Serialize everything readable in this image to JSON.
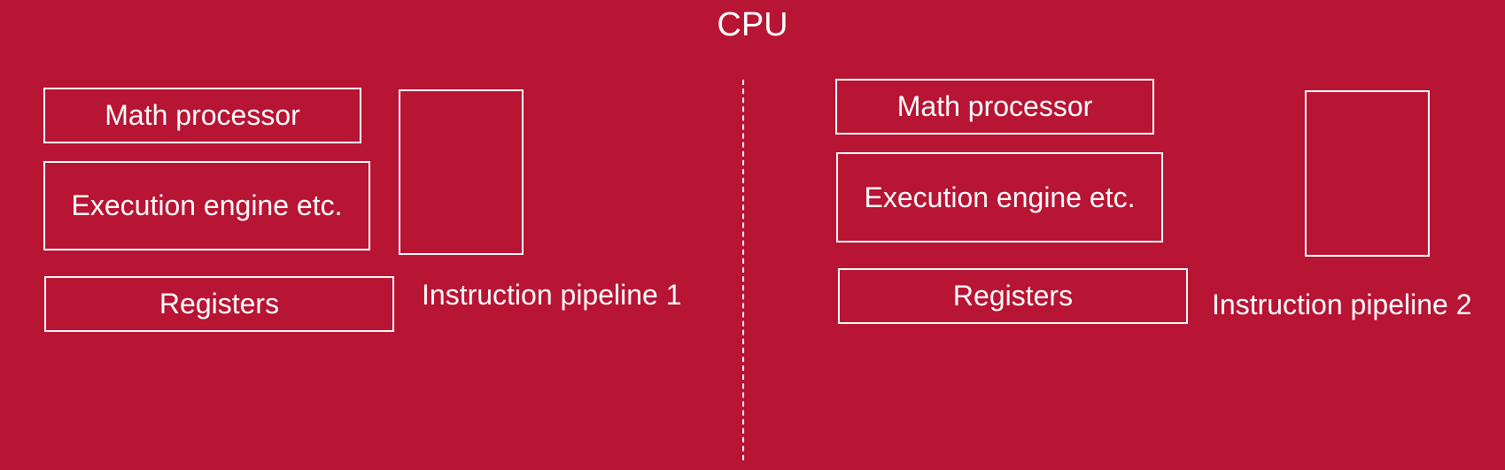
{
  "title": "CPU",
  "cores": [
    {
      "math_processor": "Math processor",
      "execution_engine": "Execution engine etc.",
      "registers": "Registers",
      "pipeline_label": "Instruction pipeline 1"
    },
    {
      "math_processor": "Math processor",
      "execution_engine": "Execution engine etc.",
      "registers": "Registers",
      "pipeline_label": "Instruction pipeline 2"
    }
  ],
  "colors": {
    "background": "#b81434",
    "foreground": "#ffffff"
  }
}
